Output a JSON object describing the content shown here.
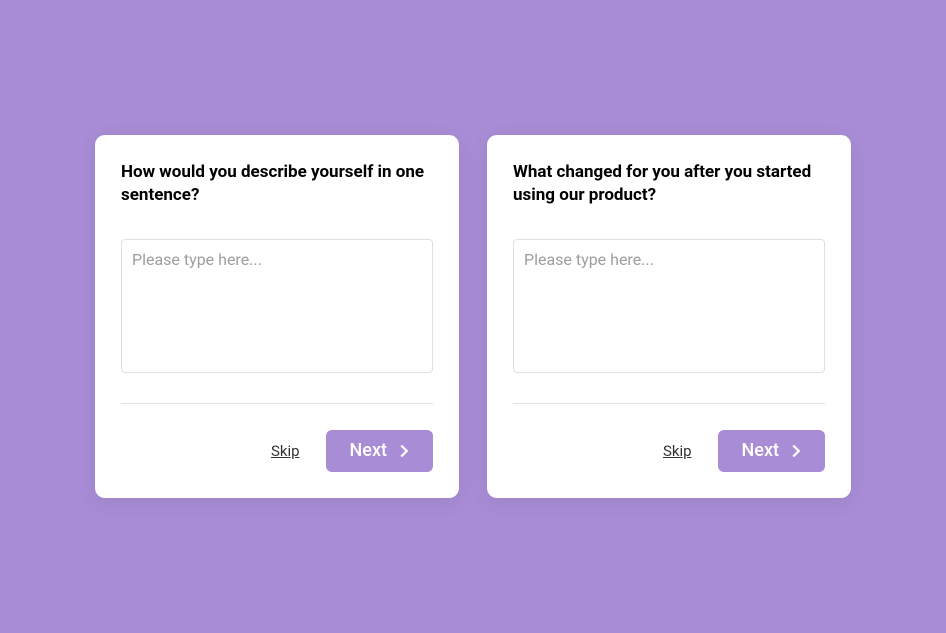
{
  "cards": [
    {
      "question": "How would you describe yourself in one sentence?",
      "placeholder": "Please type here...",
      "skip_label": "Skip",
      "next_label": "Next"
    },
    {
      "question": "What changed for you after you started using our product?",
      "placeholder": "Please type here...",
      "skip_label": "Skip",
      "next_label": "Next"
    }
  ]
}
